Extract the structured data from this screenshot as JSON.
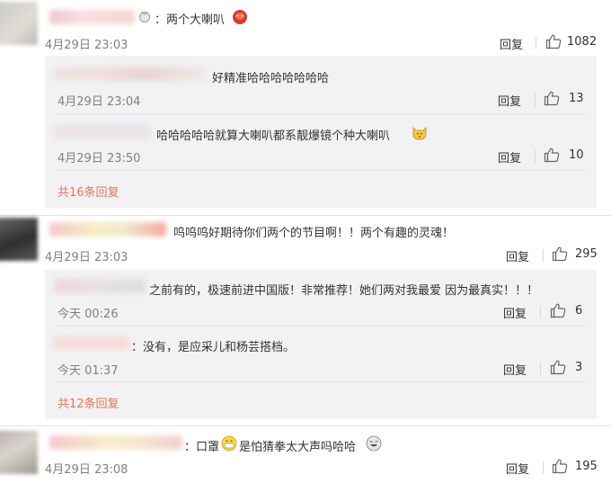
{
  "comments": [
    {
      "text": "：两个大喇叭",
      "time": "4月29日 23:03",
      "reply": "回复",
      "likes": "1082",
      "replies": [
        {
          "text": "好精准哈哈哈哈哈哈哈",
          "time": "4月29日 23:04",
          "reply": "回复",
          "likes": "13"
        },
        {
          "text": "哈哈哈哈哈就算大喇叭都系靓爆镜个种大喇叭",
          "time": "4月29日 23:50",
          "reply": "回复",
          "likes": "10"
        }
      ],
      "more": "共16条回复"
    },
    {
      "text": "呜呜呜好期待你们两个的节目啊！！两个有趣的灵魂！",
      "time": "4月29日 23:03",
      "reply": "回复",
      "likes": "295",
      "replies": [
        {
          "text": "之前有的，极速前进中国版！非常推荐！她们两对我最爱 因为最真实！！！",
          "time": "今天 00:26",
          "reply": "回复",
          "likes": "6"
        },
        {
          "text": "：没有，是应采儿和杨芸搭档。",
          "time": "今天 01:37",
          "reply": "回复",
          "likes": "3"
        }
      ],
      "more": "共12条回复"
    },
    {
      "text_a": "：口罩",
      "text_b": "是怕猜拳太大声吗哈哈",
      "time": "4月29日 23:08",
      "reply": "回复",
      "likes": "195"
    }
  ],
  "colors": {
    "link": "#eb7350",
    "muted": "#808080",
    "reply_bg": "#f2f2f5"
  }
}
